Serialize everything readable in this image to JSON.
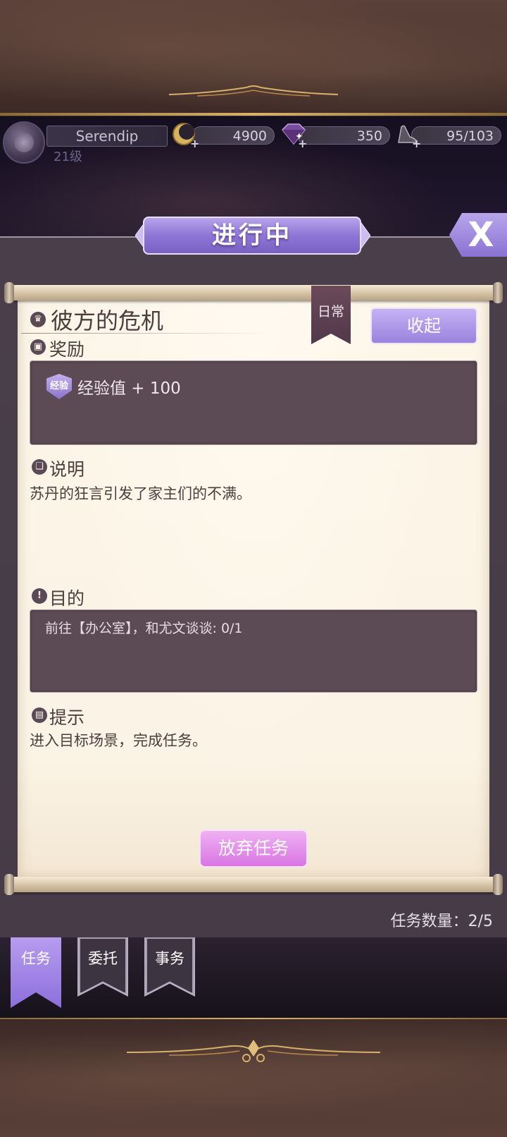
{
  "player": {
    "name": "Serendip",
    "level": "21级"
  },
  "resources": {
    "gold": "4900",
    "gems": "350",
    "stamina": "95/103"
  },
  "panel": {
    "title": "进行中",
    "close_label": "X"
  },
  "quest": {
    "title": "彼方的危机",
    "tag": "日常",
    "collapse_label": "收起",
    "reward_header": "奖励",
    "reward_badge": "经验",
    "reward_text": "经验值 + 100",
    "description_header": "说明",
    "description_text": "苏丹的狂言引发了家主们的不满。",
    "objective_header": "目的",
    "objective_text": "前往【办公室】，和尤文谈谈: 0/1",
    "hint_header": "提示",
    "hint_text": "进入目标场景，完成任务。",
    "abandon_label": "放弃任务"
  },
  "quest_count": "任务数量：2/5",
  "tabs": [
    {
      "label": "任务",
      "active": true
    },
    {
      "label": "委托",
      "active": false
    },
    {
      "label": "事务",
      "active": false
    }
  ],
  "colors": {
    "accent_purple": "#9a82de",
    "abandon_pink": "#d876e3",
    "paper": "#fbf3e5",
    "dark_box": "#5c4a54"
  }
}
